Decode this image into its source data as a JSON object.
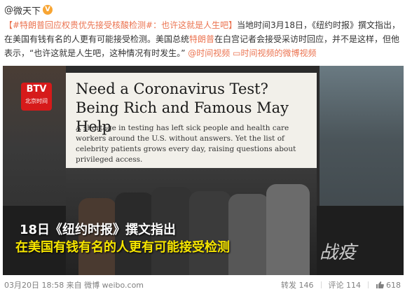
{
  "post": {
    "at_sign": "@",
    "username": "微天下",
    "verified_badge": "V",
    "text": {
      "hashtag": "【#特朗普回应权贵优先接受核酸检测#：也许这就是人生吧】",
      "main_1": "当地时间3月18日，《纽约时报》撰文指出，在美国有钱有名的人更有可能接受检测。美国总统",
      "highlight_name": "特朗普",
      "main_2": "在白宫记者会接受采访时回应，并不是这样，但他表示，“也许这就是人生吧，这种情况有时发生。”",
      "link_1": "@时间视频",
      "link_2": "时间视频的微博视频"
    }
  },
  "media": {
    "channel_logo_line1": "BTV",
    "channel_logo_line2": "北京时间",
    "headline": "Need a Coronavirus Test? Being Rich and Famous May Help",
    "summary": "A shortage in testing has left sick people and health care workers around the U.S. without answers. Yet the list of celebrity patients grows every day, raising questions about privileged access.",
    "caption_1": "18日《纽约时报》撰文指出",
    "caption_2": "在美国有钱有名的人更有可能接受检测",
    "watermark": "战疫"
  },
  "footer": {
    "meta": "03月20日 18:58 来自 微博 weibo.com",
    "repost_label": "转发",
    "repost_count": "146",
    "comment_label": "评论",
    "comment_count": "114",
    "like_count": "618"
  },
  "colors": {
    "link": "#eb7350",
    "badge": "#f8a533",
    "caption_yellow": "#f6e500"
  }
}
